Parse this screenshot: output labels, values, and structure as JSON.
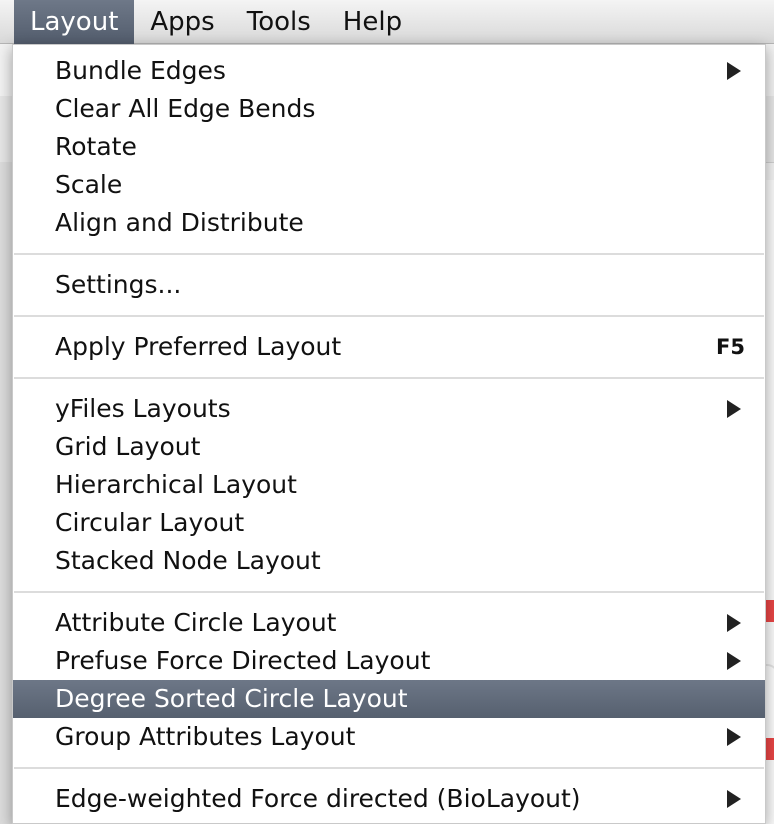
{
  "menubar": {
    "items": [
      {
        "label": "Layout"
      },
      {
        "label": "Apps"
      },
      {
        "label": "Tools"
      },
      {
        "label": "Help"
      }
    ]
  },
  "layout_menu": {
    "groups": [
      [
        {
          "label": "Bundle Edges",
          "submenu": true
        },
        {
          "label": "Clear All Edge Bends"
        },
        {
          "label": "Rotate"
        },
        {
          "label": "Scale"
        },
        {
          "label": "Align and Distribute"
        }
      ],
      [
        {
          "label": "Settings..."
        }
      ],
      [
        {
          "label": "Apply Preferred Layout",
          "shortcut": "F5"
        }
      ],
      [
        {
          "label": "yFiles Layouts",
          "submenu": true
        },
        {
          "label": "Grid Layout"
        },
        {
          "label": "Hierarchical Layout"
        },
        {
          "label": "Circular Layout"
        },
        {
          "label": "Stacked Node Layout"
        }
      ],
      [
        {
          "label": "Attribute Circle Layout",
          "submenu": true
        },
        {
          "label": "Prefuse Force Directed Layout",
          "submenu": true
        },
        {
          "label": "Degree Sorted Circle Layout",
          "highlighted": true
        },
        {
          "label": "Group Attributes Layout",
          "submenu": true
        }
      ],
      [
        {
          "label": "Edge-weighted Force directed (BioLayout)",
          "submenu": true
        }
      ]
    ]
  },
  "colors": {
    "highlight": "#5f6979",
    "edge_accent": "#e84545"
  }
}
